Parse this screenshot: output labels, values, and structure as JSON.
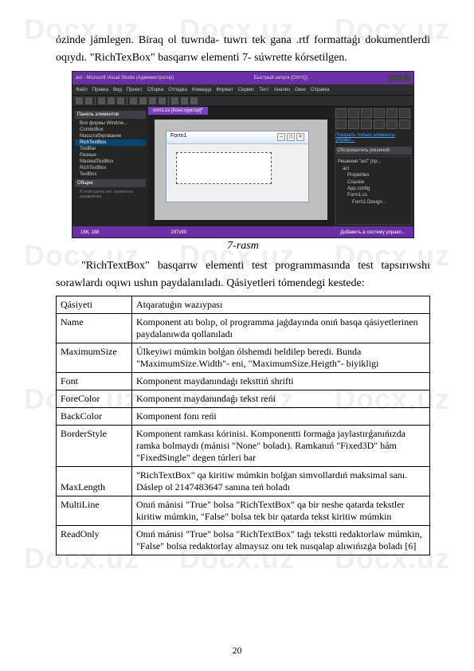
{
  "watermark": "Docx.uz",
  "paragraph1": "ózinde jámlegen. Biraq ol tuwrıda- tuwrı tek gana .rtf formattaǵı dokumentlerdi oqıydı. \"RichTexBox\" basqarıw elementi 7- súwrette kórsetilgen.",
  "screenshot": {
    "title_left": "act - Microsoft Visual Studio (Администратор)",
    "title_right": "Быстрый запуск (Ctrl+Q)",
    "menu": [
      "Файл",
      "Правка",
      "Вид",
      "Проект",
      "Сборка",
      "Отладка",
      "Команда",
      "Формат",
      "Сервис",
      "Тест",
      "Анализ",
      "Окно",
      "Справка"
    ],
    "panel_header": "Панель элементов",
    "tree_items": [
      "Все формы Window...",
      "ComboBox",
      "Масштабирование",
      "RichTextBox",
      "ToolBar",
      "Разные",
      "MaskedTextBox",
      "RichTextBox",
      "TextBox"
    ],
    "tree_footer": "Общие",
    "tree_tip": "В этой группе нет элементов управления.",
    "tab": "orm1.cs [Конструктор]*",
    "form_title": "Form1",
    "right_link": "Показать только элементы управл...",
    "right_header": "Обозреватель решений",
    "sol_items": [
      "Решение \"act\" (пр...",
      "act",
      "Properties",
      "Ссылки",
      "App.config",
      "Form1.cs",
      "Form1.Design..."
    ],
    "status_left": "186, 188",
    "status_mid": "297x90",
    "status_right": "Добавить в систему управл..."
  },
  "caption": "7-rasm",
  "paragraph2": "\"RichTextBox\" basqarıw elementi test programmasında test tapsırıwshı sorawlardı oqıwı ushın paydalanıladı. Qásiyetleri tómendegi kestede:",
  "table": {
    "header": {
      "c0": "Qásiyeti",
      "c1": "Atqaratuǵın wazıypası"
    },
    "rows": [
      {
        "c0": "Name",
        "c1": "Komponent atı bolıp, ol programma jaǵdayında onıń basqa qásiyetlerinen paydalanıwda qollanıladı"
      },
      {
        "c0": "MaximumSize",
        "c1": "Úlkeyiwi múmkin bolǵan ólshemdi beldilep beredi. Bunda \"MaximumSize.Width\"- eni, \"MaximumSize.Heigth\"- biyikligi"
      },
      {
        "c0": "Font",
        "c1": "Komponent maydanındaǵı teksttiń shrifti"
      },
      {
        "c0": "ForeColor",
        "c1": "Komponent maydanındaǵı tekst reńi"
      },
      {
        "c0": "BackColor",
        "c1": "Komponent fonı reńi"
      },
      {
        "c0": "BorderStyle",
        "c1": "Komponent ramkası kórinisi. Komponentti formaǵa jaylastırǵanıńızda ramka bolmaydı (mánisi \"None\" boladı). Ramkanıń \"Fixed3D\" hám \"FixedSingle\" degen túrleri bar"
      },
      {
        "c0": "MaxLength",
        "c1": "\"RichTextBox\" qa kiritiw múmkin bolǵan simvollardıń maksimal sanı. Dáslep ol 2147483647 sanına teń boladı"
      },
      {
        "c0": "MultiLine",
        "c1": "Onıń mánisi \"True\" bolsa \"RichTextBox\" qa bir neshe qatarda tekstler kiritiw múmkin, \"False\" bolsa tek bir qatarda tekst kiritiw múmkin"
      },
      {
        "c0": "ReadOnly",
        "c1": "Onıń mánisi \"True\" bolsa \"RichTextBox\" taǵı tekstti redaktorlaw múmkin, \"False\" bolsa redaktorlay almaysız onı tek nusqalap alıwıńızǵa boladı [6]"
      }
    ]
  },
  "page_number": "20"
}
